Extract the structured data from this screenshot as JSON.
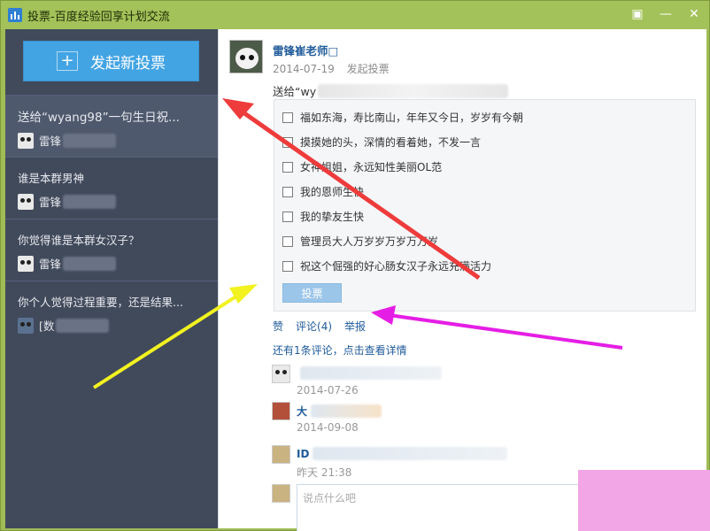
{
  "window": {
    "title": "投票-百度经验回享计划交流",
    "controls": [
      "feedback-icon",
      "minimize-icon",
      "close-icon"
    ]
  },
  "sidebar": {
    "new_vote_label": "发起新投票",
    "items": [
      {
        "title": "送给“wyang98”一句生日祝...",
        "author": "雷锋",
        "active": true
      },
      {
        "title": "谁是本群男神",
        "author": "雷锋",
        "active": false
      },
      {
        "title": "你觉得谁是本群女汉子？",
        "author": "雷锋",
        "active": false
      },
      {
        "title": "你个人觉得过程重要，还是结果...",
        "author": "[数",
        "active": false
      }
    ]
  },
  "post": {
    "author": "雷锋崔老师□",
    "date": "2014-07-19",
    "action": "发起投票",
    "text": "送给“wy",
    "options": [
      "福如东海，寿比南山，年年又今日，岁岁有今朝",
      "摸摸她的头，深情的看着她，不发一言",
      "女神姐姐，永远知性美丽OL范",
      "我的恩师生快",
      "我的挚友生快",
      "管理员大人万岁岁万岁万万岁",
      "祝这个倔强的好心肠女汉子永远充满活力"
    ],
    "vote_button": "投票",
    "actions": {
      "like": "赞",
      "comment": "评论(4)",
      "report": "举报"
    },
    "more_comments": "还有1条评论，点击查看详情"
  },
  "comments": [
    {
      "name": "",
      "time": "2014-07-26"
    },
    {
      "name": "大",
      "time": "2014-09-08"
    },
    {
      "name": "ID",
      "time": "昨天 21:38"
    }
  ],
  "reply": {
    "placeholder": "说点什么吧"
  },
  "colors": {
    "titlebar": "#a3c259",
    "sidebar": "#414a5b",
    "accent": "#43a4e4",
    "link": "#1f5a9a"
  }
}
